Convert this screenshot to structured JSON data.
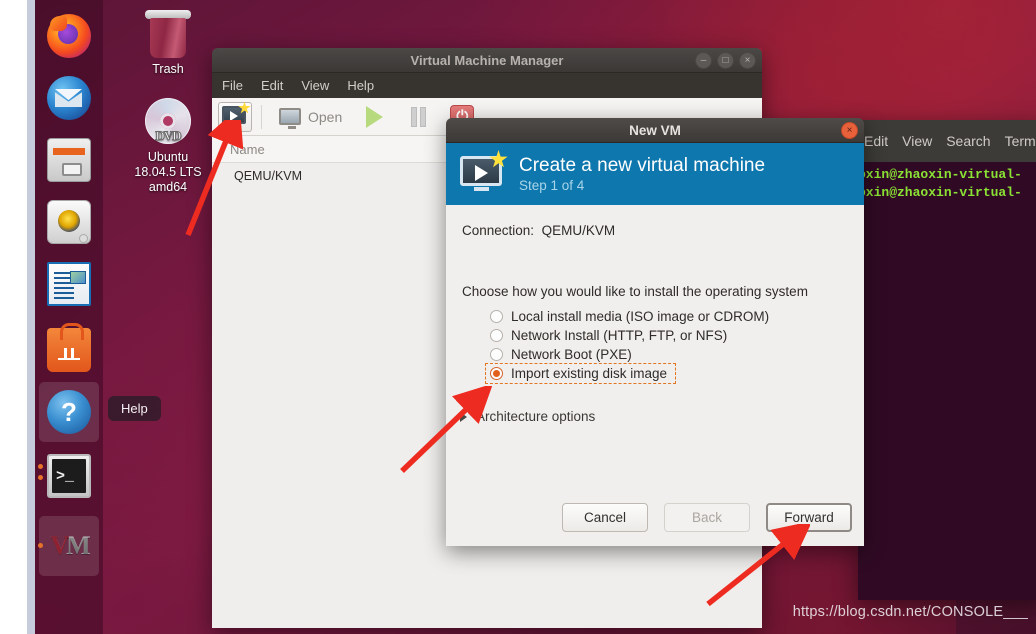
{
  "desktop": {
    "icons": [
      {
        "name": "Trash",
        "label": "Trash",
        "icon": "trash-icon"
      },
      {
        "name": "ubuntu-iso",
        "label": "Ubuntu\n18.04.5 LTS\namd64",
        "label_line1": "Ubuntu",
        "label_line2": "18.04.5 LTS",
        "label_line3": "amd64",
        "icon": "dvd-disc-icon"
      }
    ],
    "watermark": "https://blog.csdn.net/CONSOLE___"
  },
  "launcher": {
    "items": [
      {
        "label": "Firefox",
        "icon": "firefox-icon",
        "running": false,
        "active": false
      },
      {
        "label": "Thunderbird Mail",
        "icon": "thunderbird-icon",
        "running": false,
        "active": false
      },
      {
        "label": "Files",
        "icon": "files-cabinet-icon",
        "running": false,
        "active": false
      },
      {
        "label": "Rhythmbox",
        "icon": "rhythmbox-icon",
        "running": false,
        "active": false
      },
      {
        "label": "LibreOffice Writer",
        "icon": "libreoffice-writer-icon",
        "running": false,
        "active": false
      },
      {
        "label": "Ubuntu Software",
        "icon": "ubuntu-software-icon",
        "running": false,
        "active": false
      },
      {
        "label": "Help",
        "icon": "help-icon",
        "running": false,
        "active": true
      },
      {
        "label": "Terminal",
        "icon": "terminal-icon",
        "running": true,
        "active": false
      },
      {
        "label": "Virtual Machine Manager",
        "icon": "vmm-icon",
        "running": true,
        "active": true
      }
    ],
    "tooltip": "Help"
  },
  "vmm_window": {
    "title": "Virtual Machine Manager",
    "menu": [
      "File",
      "Edit",
      "View",
      "Help"
    ],
    "toolbar": {
      "new_vm": "new-vm-icon",
      "open_label": "Open",
      "run_label": "run-icon",
      "pause_label": "pause-icon",
      "shutdown_label": "shutdown-icon"
    },
    "list": {
      "column_header": "Name",
      "rows": [
        "QEMU/KVM"
      ]
    },
    "window_buttons": {
      "minimize": "–",
      "maximize": "□",
      "close": "×"
    }
  },
  "terminal_window": {
    "menu": [
      "Edit",
      "View",
      "Search",
      "Term"
    ],
    "lines": [
      "oxin@zhaoxin-virtual-",
      "oxin@zhaoxin-virtual-"
    ]
  },
  "new_vm_dialog": {
    "title": "New VM",
    "close_button": "×",
    "banner": {
      "heading": "Create a new virtual machine",
      "subheading": "Step 1 of 4",
      "icon": "new-vm-monitor-star-icon"
    },
    "connection_label": "Connection:",
    "connection_value": "QEMU/KVM",
    "prompt": "Choose how you would like to install the operating system",
    "options": [
      {
        "label": "Local install media (ISO image or CDROM)",
        "selected": false
      },
      {
        "label": "Network Install (HTTP, FTP, or NFS)",
        "selected": false
      },
      {
        "label": "Network Boot (PXE)",
        "selected": false
      },
      {
        "label": "Import existing disk image",
        "selected": true
      }
    ],
    "architecture_label": "Architecture options",
    "buttons": {
      "cancel": "Cancel",
      "back": "Back",
      "forward": "Forward"
    }
  },
  "colors": {
    "banner_blue": "#0e77ad",
    "accent_orange": "#e2601c",
    "annotation_red": "#ee2b20",
    "terminal_bg": "#300a24",
    "terminal_text": "#8ae234",
    "wallpaper": "#73183f"
  }
}
